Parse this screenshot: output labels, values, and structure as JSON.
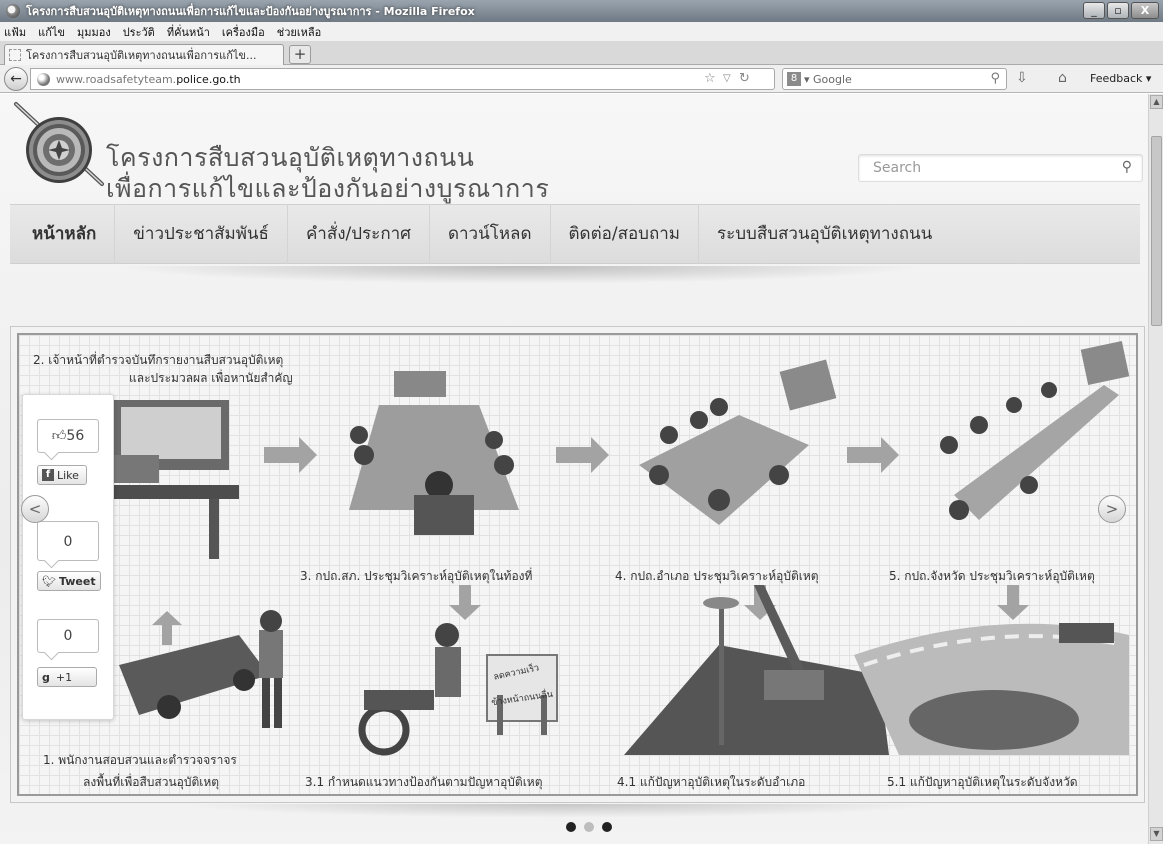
{
  "window": {
    "title": "โครงการสืบสวนอุบัติเหตุทางถนนเพื่อการแก้ไขและป้องกันอย่างบูรณาการ - Mozilla Firefox",
    "min": "_",
    "max": "▫",
    "close": "X"
  },
  "menu": [
    "แฟ้ม",
    "แก้ไข",
    "มุมมอง",
    "ประวัติ",
    "ที่คั่นหน้า",
    "เครื่องมือ",
    "ช่วยเหลือ"
  ],
  "tab": {
    "label": "โครงการสืบสวนอุบัติเหตุทางถนนเพื่อการแก้ไข...",
    "new_tab": "+"
  },
  "navbar": {
    "back": "←",
    "url_host": "www.roadsafetyteam.",
    "url_domain": "police.go.th",
    "search_engine_mark": "8",
    "search_placeholder": "▾ Google",
    "feedback": "Feedback ▾"
  },
  "site": {
    "title_line1": "โครงการสืบสวนอุบัติเหตุทางถนน",
    "title_line2": "เพื่อการแก้ไขและป้องกันอย่างบูรณาการ",
    "search_placeholder": "Search"
  },
  "nav": [
    "หน้าหลัก",
    "ข่าวประชาสัมพันธ์",
    "คำสั่ง/ประกาศ",
    "ดาวน์โหลด",
    "ติดต่อ/สอบถาม",
    "ระบบสืบสวนอุบัติเหตุทางถนน"
  ],
  "slide": {
    "step2_line1": "2. เจ้าหน้าที่ตำรวจบันทึกรายงานสืบสวนอุบัติเหตุ",
    "step2_line2": "และประมวลผล เพื่อหานัยสำคัญ",
    "step3": "3. กปถ.สภ. ประชุมวิเคราะห์อุบัติเหตุในท้องที่",
    "step4": "4. กปถ.อำเภอ ประชุมวิเคราะห์อุบัติเหตุ",
    "step5": "5. กปถ.จังหวัด ประชุมวิเคราะห์อุบัติเหตุ",
    "step1_line1": "1. พนักงานสอบสวนและตำรวจจราจร",
    "step1_line2": "ลงพื้นที่เพื่อสืบสวนอุบัติเหตุ",
    "step31": "3.1 กำหนดแนวทางป้องกันตามปัญหาอุบัติเหตุ",
    "step41": "4.1 แก้ปัญหาอุบัติเหตุในระดับอำเภอ",
    "step51": "5.1 แก้ปัญหาอุบัติเหตุในระดับจังหวัด",
    "sign1": "ลดความเร็ว",
    "sign2": "ข้างหน้าถนนลื่น"
  },
  "share": {
    "like_count": "56",
    "like_label": "Like",
    "tweet_count": "0",
    "tweet_label": "Tweet",
    "plus_count": "0",
    "plus_label": "+1"
  },
  "slider_nav": {
    "prev": "<",
    "next": ">"
  }
}
